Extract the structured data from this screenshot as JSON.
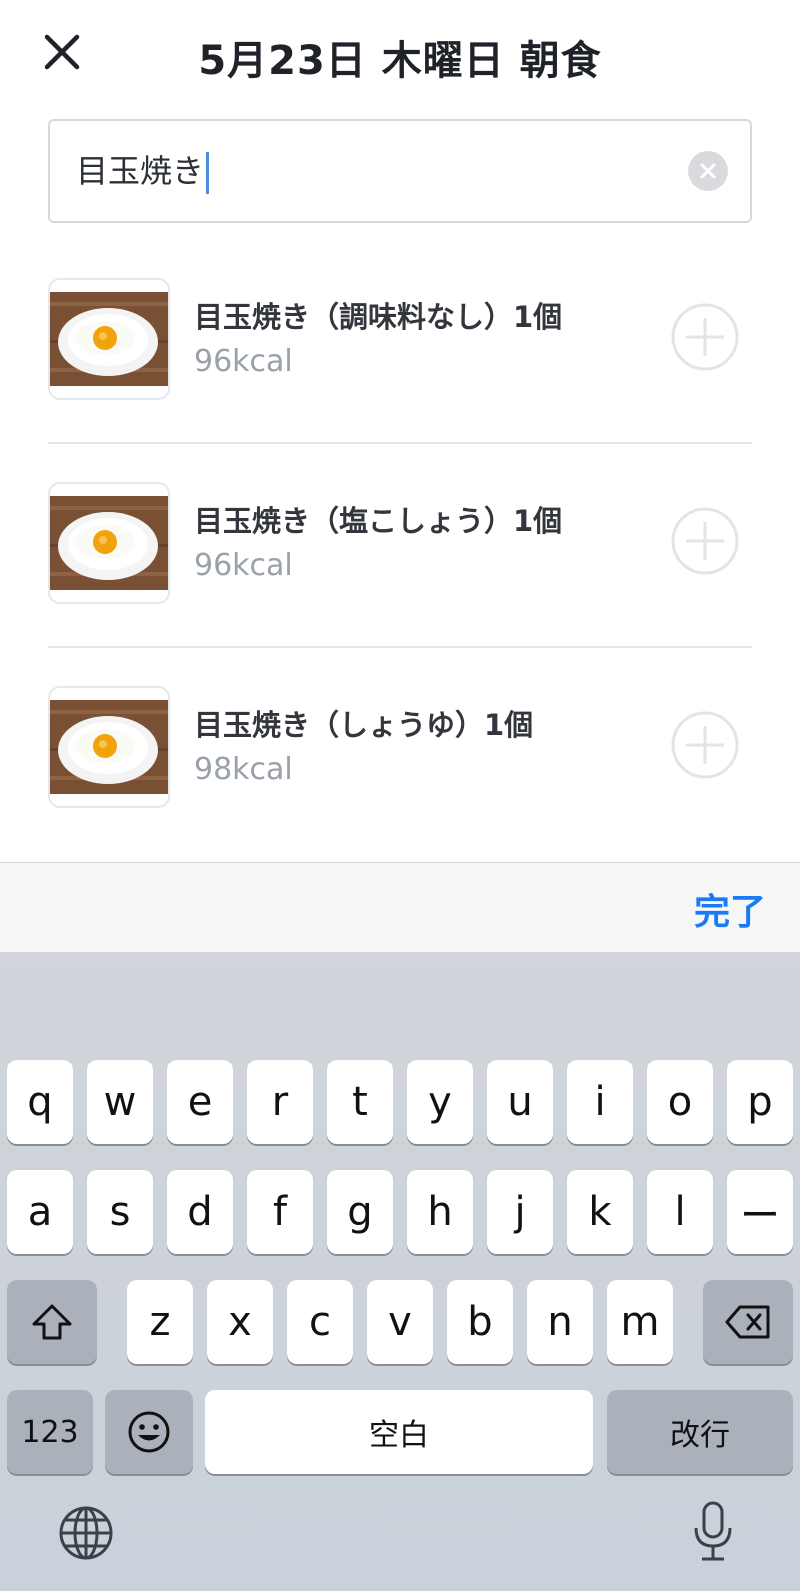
{
  "header": {
    "title": "5月23日 木曜日 朝食",
    "close_icon": "close-icon"
  },
  "search": {
    "value": "目玉焼き",
    "clear_icon": "clear-circle-icon"
  },
  "results": [
    {
      "name": "目玉焼き（調味料なし）1個",
      "kcal": "96kcal",
      "image": "fried-egg-photo",
      "add_icon": "plus-circle-icon"
    },
    {
      "name": "目玉焼き（塩こしょう）1個",
      "kcal": "96kcal",
      "image": "fried-egg-photo",
      "add_icon": "plus-circle-icon"
    },
    {
      "name": "目玉焼き（しょうゆ）1個",
      "kcal": "98kcal",
      "image": "fried-egg-photo",
      "add_icon": "plus-circle-icon"
    }
  ],
  "toolbar": {
    "done_label": "完了"
  },
  "keyboard": {
    "row1": [
      "q",
      "w",
      "e",
      "r",
      "t",
      "y",
      "u",
      "i",
      "o",
      "p"
    ],
    "row2": [
      "a",
      "s",
      "d",
      "f",
      "g",
      "h",
      "j",
      "k",
      "l",
      "ー"
    ],
    "row3": [
      "z",
      "x",
      "c",
      "v",
      "b",
      "n",
      "m"
    ],
    "numbers_label": "123",
    "space_label": "空白",
    "return_label": "改行",
    "icons": [
      "shift-icon",
      "backspace-icon",
      "emoji-icon",
      "globe-icon",
      "microphone-icon"
    ]
  },
  "colors": {
    "accent": "#1a7cf5",
    "kcal": "#9aa1ab",
    "divider": "#e3e5e8",
    "keyboard_bg": "#d1d4da"
  }
}
